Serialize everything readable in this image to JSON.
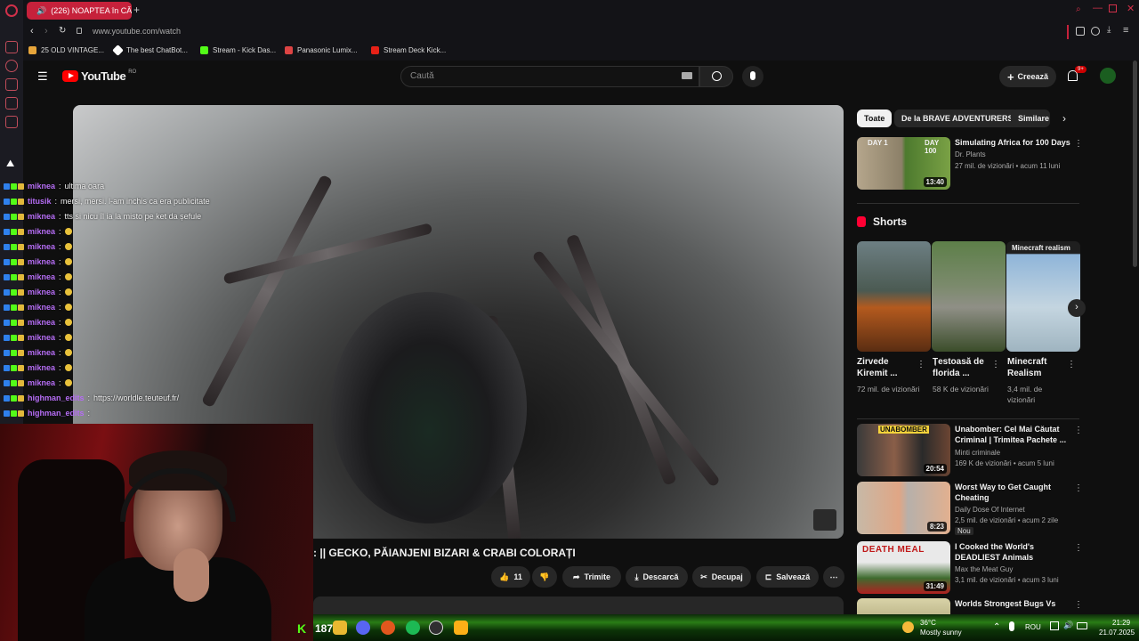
{
  "browser": {
    "tab_title": "(226) NOAPTEA în CĂ",
    "url": "www.youtube.com/watch",
    "bookmarks": [
      {
        "label": "25 OLD VINTAGE...",
        "color": "#e7a53b"
      },
      {
        "label": "The best ChatBot...",
        "color": "#ffffff"
      },
      {
        "label": "Stream - Kick Das...",
        "color": "#53fc18"
      },
      {
        "label": "Panasonic Lumix...",
        "color": "#d44"
      },
      {
        "label": "Stream Deck Kick...",
        "color": "#e62117"
      }
    ]
  },
  "youtube": {
    "logo": "YouTube",
    "region": "RO",
    "search_placeholder": "Caută",
    "create_label": "Creează",
    "notif_count": "9+",
    "video_title": ": || GECKO, PĂIANJENI BIZARI & CRABI COLORAȚI",
    "actions": {
      "likes": "11",
      "share": "Trimite",
      "download": "Descarcă",
      "clip": "Decupaj",
      "save": "Salvează"
    },
    "chips": [
      "Toate",
      "De la BRAVE ADVENTURERS",
      "Similare"
    ],
    "top_rec": {
      "title": "Simulating Africa for 100 Days",
      "channel": "Dr. Plants",
      "meta": "27 mil. de vizionări • acum 11 luni",
      "duration": "13:40",
      "thumb_left": "DAY 1",
      "thumb_right": "DAY 100"
    },
    "shorts_label": "Shorts",
    "shorts": [
      {
        "title": "Zirvede Kiremit ...",
        "meta": "72 mil. de vizionări",
        "overlay": ""
      },
      {
        "title": "Țestoasă de florida ...",
        "meta": "58 K de vizionări",
        "overlay": ""
      },
      {
        "title": "Minecraft Realism",
        "meta": "3,4 mil. de vizionări",
        "overlay": "Minecraft realism"
      }
    ],
    "recs": [
      {
        "title": "Unabomber: Cel Mai Căutat Criminal | Trimitea Pachete ...",
        "channel": "Minti criminale",
        "meta": "169 K de vizionări • acum 5 luni",
        "duration": "20:54",
        "badge": "",
        "thumb_text": "UNABOMBER"
      },
      {
        "title": "Worst Way to Get Caught Cheating",
        "channel": "Daily Dose Of Internet",
        "meta": "2,5 mil. de vizionări • acum 2 zile",
        "duration": "8:23",
        "badge": "Nou",
        "thumb_text": ""
      },
      {
        "title": "I Cooked the World's DEADLIEST Animals",
        "channel": "Max the Meat Guy",
        "meta": "3,1 mil. de vizionări • acum 3 luni",
        "duration": "31:49",
        "badge": "",
        "thumb_text": "DEATH MEAL"
      },
      {
        "title": "Worlds Strongest Bugs Vs",
        "channel": "",
        "meta": "",
        "duration": "",
        "badge": "",
        "thumb_text": ""
      }
    ]
  },
  "chat": [
    {
      "user": "miknea",
      "msg": "ultima oara",
      "emote": false
    },
    {
      "user": "titusik",
      "msg": "mersi, mersi. l-am inchis ca era publicitate",
      "emote": false
    },
    {
      "user": "miknea",
      "msg": "tts si nicu îl ia la misto pe ket da șefule",
      "emote": false
    },
    {
      "user": "miknea",
      "msg": "",
      "emote": true
    },
    {
      "user": "miknea",
      "msg": "",
      "emote": true
    },
    {
      "user": "miknea",
      "msg": "",
      "emote": true
    },
    {
      "user": "miknea",
      "msg": "",
      "emote": true
    },
    {
      "user": "miknea",
      "msg": "",
      "emote": true
    },
    {
      "user": "miknea",
      "msg": "",
      "emote": true
    },
    {
      "user": "miknea",
      "msg": "",
      "emote": true
    },
    {
      "user": "miknea",
      "msg": "",
      "emote": true
    },
    {
      "user": "miknea",
      "msg": "",
      "emote": true
    },
    {
      "user": "miknea",
      "msg": "",
      "emote": true
    },
    {
      "user": "miknea",
      "msg": "",
      "emote": true
    },
    {
      "user": "highman_edits",
      "msg": "https://worldle.teuteuf.fr/",
      "emote": false
    },
    {
      "user": "highman_edits",
      "msg": "",
      "emote": false
    }
  ],
  "taskbar": {
    "kick_count": "187",
    "weather_temp": "36°C",
    "weather_desc": "Mostly sunny",
    "lang": "ROU",
    "time": "21:29",
    "date": "21.07.2025"
  },
  "colors": {
    "accent_red": "#c6213b",
    "chat_user": "#b46cf3",
    "kick_green": "#53fc18"
  }
}
